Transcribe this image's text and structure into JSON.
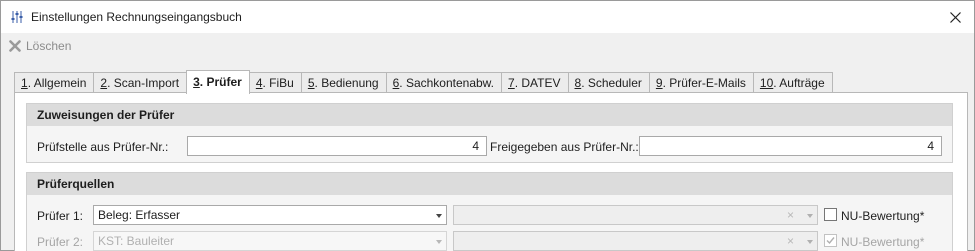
{
  "window": {
    "title": "Einstellungen Rechnungseingangsbuch",
    "close_glyph": "✕"
  },
  "toolbar": {
    "delete_label": "Löschen",
    "delete_icon": "delete-x-icon"
  },
  "tabs": [
    {
      "num": "1",
      "label": ". Allgemein",
      "active": false
    },
    {
      "num": "2",
      "label": ". Scan-Import",
      "active": false
    },
    {
      "num": "3",
      "label": ". Prüfer",
      "active": true
    },
    {
      "num": "4",
      "label": ". FiBu",
      "active": false
    },
    {
      "num": "5",
      "label": ". Bedienung",
      "active": false
    },
    {
      "num": "6",
      "label": ". Sachkontenabw.",
      "active": false
    },
    {
      "num": "7",
      "label": ". DATEV",
      "active": false
    },
    {
      "num": "8",
      "label": ". Scheduler",
      "active": false
    },
    {
      "num": "9",
      "label": ". Prüfer-E-Mails",
      "active": false
    },
    {
      "num": "10",
      "label": ". Aufträge",
      "active": false
    }
  ],
  "assignments": {
    "header": "Zuweisungen der Prüfer",
    "pruefstelle_label": "Prüfstelle aus Prüfer-Nr.:",
    "pruefstelle_value": "4",
    "freigegeben_label": "Freigegeben aus Prüfer-Nr.:",
    "freigegeben_value": "4"
  },
  "sources": {
    "header": "Prüferquellen",
    "rows": [
      {
        "label": "Prüfer 1:",
        "value": "Beleg: Erfasser",
        "nu_label": "NU-Bewertung*",
        "nu_checked": false,
        "disabled": false
      },
      {
        "label": "Prüfer 2:",
        "value": "KST: Bauleiter",
        "nu_label": "NU-Bewertung*",
        "nu_checked": true,
        "disabled": true
      }
    ],
    "clear_glyph": "×"
  },
  "colors": {
    "accent_delete": "#8c8c8c",
    "group_header_bg": "#dcdcdc"
  }
}
